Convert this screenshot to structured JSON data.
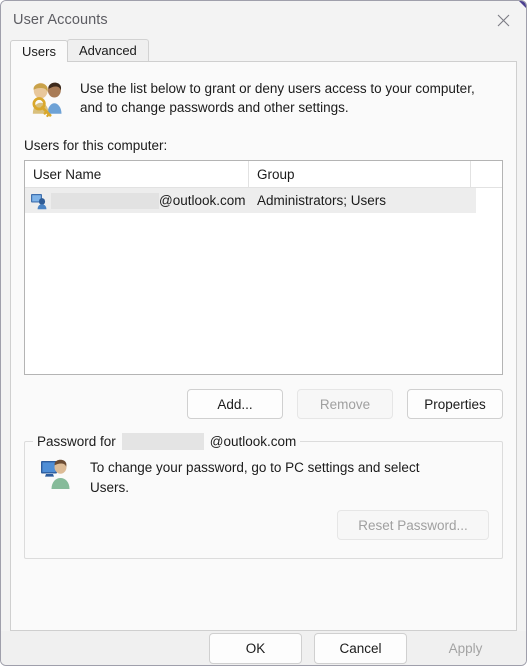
{
  "window": {
    "title": "User Accounts",
    "close_icon": "close-icon",
    "accent_color": "#4b3f8f"
  },
  "tabs": [
    {
      "label": "Users",
      "active": true
    },
    {
      "label": "Advanced",
      "active": false
    }
  ],
  "intro": {
    "icon": "two-users-with-key-icon",
    "text": "Use the list below to grant or deny users access to your computer, and to change passwords and other settings."
  },
  "users_list": {
    "label": "Users for this computer:",
    "columns": [
      "User Name",
      "Group"
    ],
    "rows": [
      {
        "icon": "user-account-icon",
        "user_name_redacted": "",
        "user_name_suffix": "@outlook.com",
        "group": "Administrators; Users",
        "selected": true
      }
    ]
  },
  "list_buttons": [
    {
      "label": "Add...",
      "enabled": true
    },
    {
      "label": "Remove",
      "enabled": false
    },
    {
      "label": "Properties",
      "enabled": true
    }
  ],
  "password_group": {
    "legend_prefix": "Password for",
    "legend_redacted": "",
    "legend_suffix": "@outlook.com",
    "icon": "user-at-monitor-icon",
    "text": "To change your password, go to PC settings and select Users.",
    "reset_button": {
      "label": "Reset Password...",
      "enabled": false
    }
  },
  "footer_buttons": [
    {
      "label": "OK",
      "enabled": true
    },
    {
      "label": "Cancel",
      "enabled": true
    },
    {
      "label": "Apply",
      "enabled": false
    }
  ]
}
